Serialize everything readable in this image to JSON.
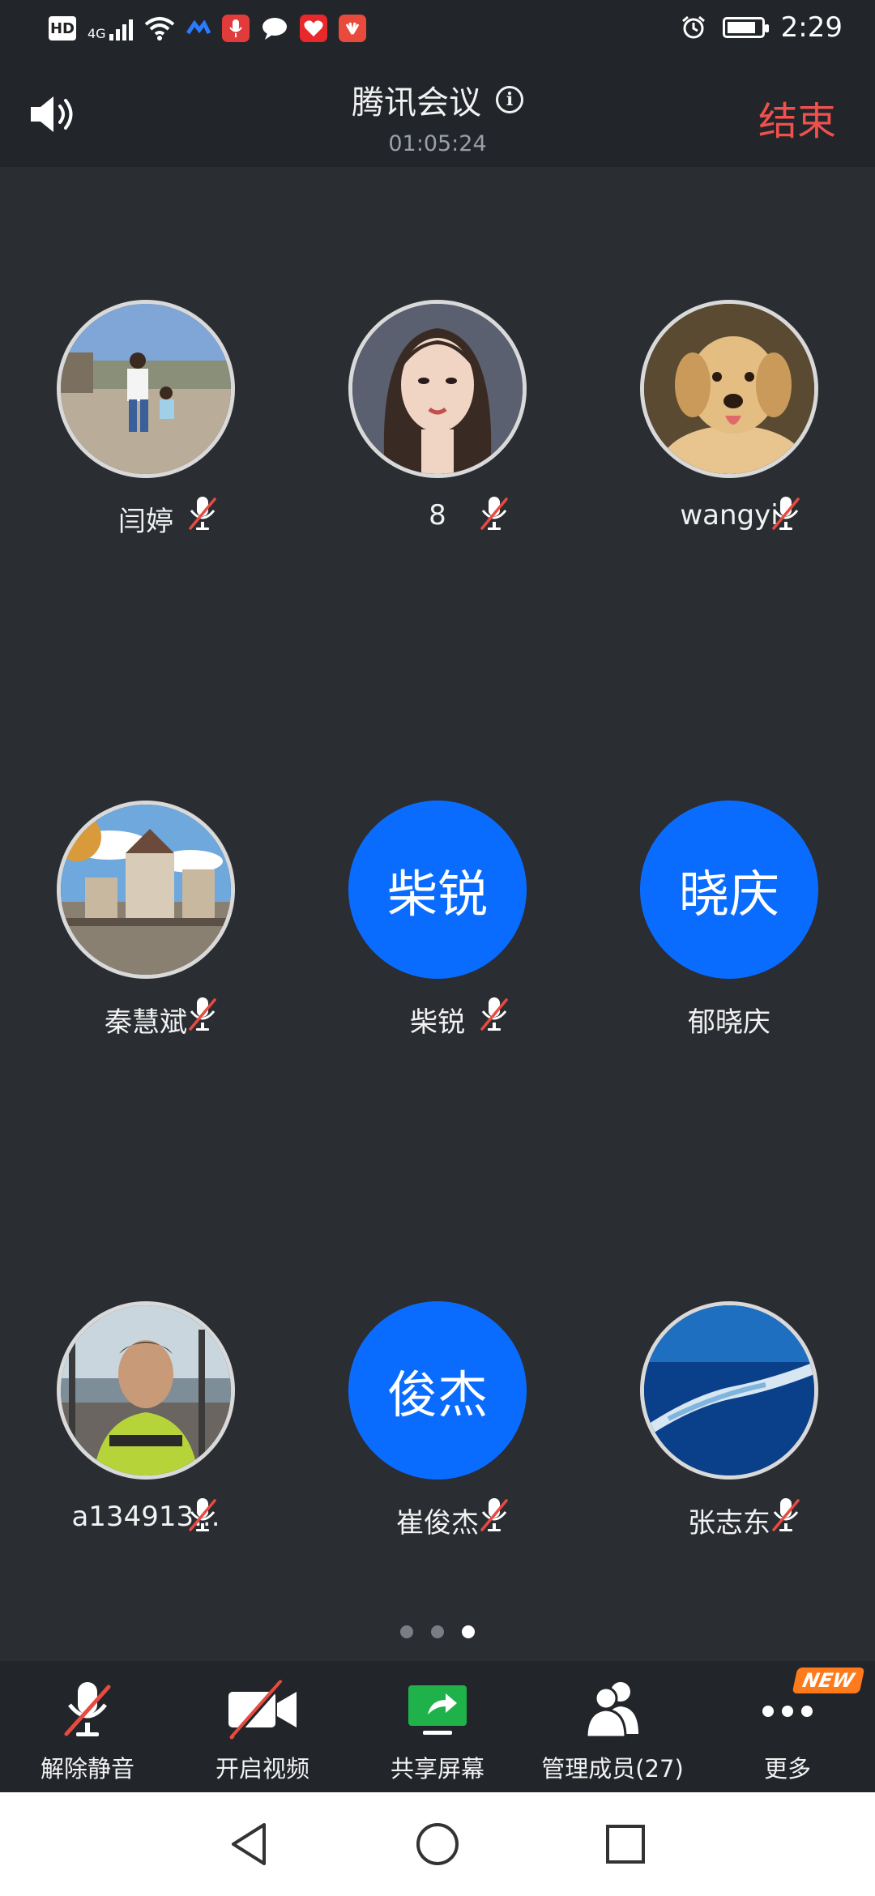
{
  "status_bar": {
    "time": "2:29",
    "network": "4G",
    "hd_label": "HD",
    "battery_level": 0.85
  },
  "header": {
    "title": "腾讯会议",
    "timer": "01:05:24",
    "end_label": "结束"
  },
  "participants": [
    {
      "name": "闫婷",
      "avatar": "photo",
      "photo": "family-great-wall",
      "muted": true
    },
    {
      "name": "8",
      "avatar": "photo",
      "photo": "woman-portrait",
      "muted": true
    },
    {
      "name": "wangyi",
      "avatar": "photo",
      "photo": "golden-retriever",
      "muted": true
    },
    {
      "name": "秦慧斌",
      "avatar": "photo",
      "photo": "castle-landscape",
      "muted": true
    },
    {
      "name": "柴锐",
      "avatar": "text",
      "avatar_text": "柴锐",
      "muted": true
    },
    {
      "name": "郁晓庆",
      "avatar": "text",
      "avatar_text": "晓庆",
      "muted": false
    },
    {
      "name": "a134913...",
      "avatar": "photo",
      "photo": "man-lakeside",
      "muted": true
    },
    {
      "name": "崔俊杰",
      "avatar": "text",
      "avatar_text": "俊杰",
      "muted": true
    },
    {
      "name": "张志东",
      "avatar": "photo",
      "photo": "ocean-coastline",
      "muted": true
    }
  ],
  "pagination": {
    "total": 3,
    "current": 3
  },
  "toolbar": {
    "unmute_label": "解除静音",
    "video_label": "开启视频",
    "share_label": "共享屏幕",
    "members_label": "管理成员(27)",
    "more_label": "更多",
    "new_badge": "NEW"
  },
  "colors": {
    "accent": "#0a6cff",
    "end": "#f0514d",
    "share_green": "#1fb24a",
    "badge": "#ff7a1a"
  }
}
